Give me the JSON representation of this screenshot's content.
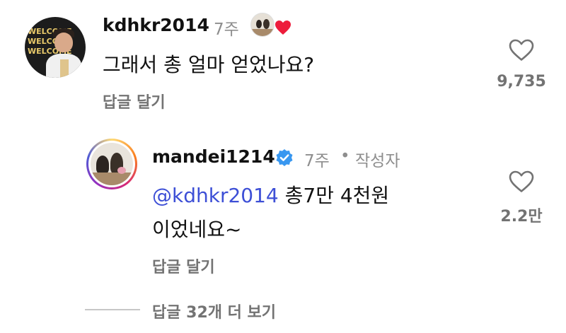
{
  "comment": {
    "username": "kdhkr2014",
    "time": "7주",
    "text": "그래서 총 얼마 얻었나요?",
    "reply_label": "답글 달기",
    "like_count": "9,735",
    "author_liked": true
  },
  "reply": {
    "username": "mandei1214",
    "verified": true,
    "time": "7주",
    "separator": "•",
    "author_label": "작성자",
    "mention": "@kdhkr2014",
    "text_line1": " 총7만 4천원",
    "text_line2": "이었네요~",
    "reply_label": "답글 달기",
    "like_count": "2.2만"
  },
  "more_replies": "답글 32개 더 보기",
  "colors": {
    "mention": "#3d4fd6",
    "verified": "#3897f0",
    "heart": "#ed1c3b",
    "muted": "#737373"
  },
  "icons": {
    "avatar1_text": "WELCOME"
  }
}
